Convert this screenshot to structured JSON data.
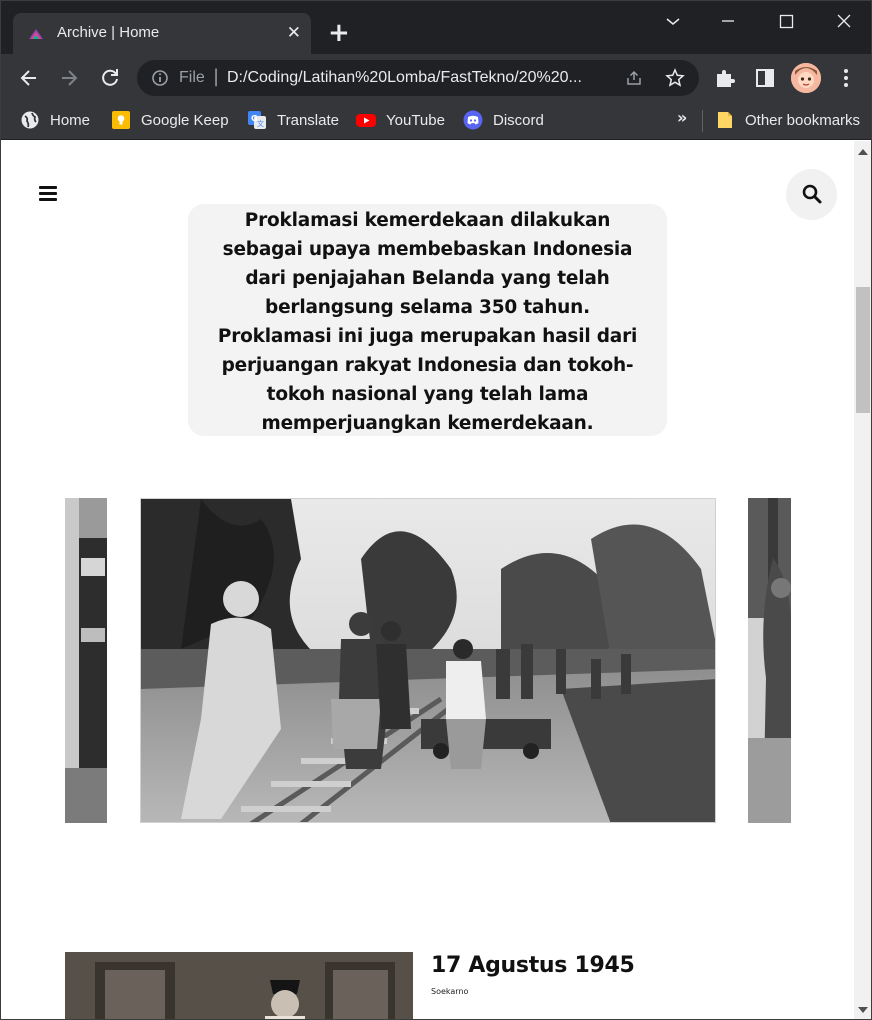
{
  "browser": {
    "tab": {
      "title": "Archive | Home"
    },
    "address": {
      "scheme": "File",
      "url": "D:/Coding/Latihan%20Lomba/FastTekno/20%20..."
    },
    "bookmarks": [
      {
        "label": "Home",
        "icon": "globe-icon"
      },
      {
        "label": "Google Keep",
        "icon": "google-keep-icon"
      },
      {
        "label": "Translate",
        "icon": "google-translate-icon"
      },
      {
        "label": "YouTube",
        "icon": "youtube-icon"
      },
      {
        "label": "Discord",
        "icon": "discord-icon"
      }
    ],
    "bookmarks_overflow": "»",
    "other_bookmarks": "Other bookmarks"
  },
  "page": {
    "intro": "Proklamasi kemerdekaan dilakukan sebagai upaya membebaskan Indonesia dari penjajahan Belanda yang telah berlangsung selama 350 tahun. Proklamasi ini juga merupakan hasil dari perjuangan rakyat Indonesia dan tokoh-tokoh nasional yang telah lama memperjuangkan kemerdekaan.",
    "event": {
      "title": "17 Agustus 1945",
      "subtitle": "Soekarno"
    }
  },
  "colors": {
    "tabstrip": "#202124",
    "toolbar": "#35363a",
    "card": "#f3f3f3",
    "text": "#111111"
  }
}
